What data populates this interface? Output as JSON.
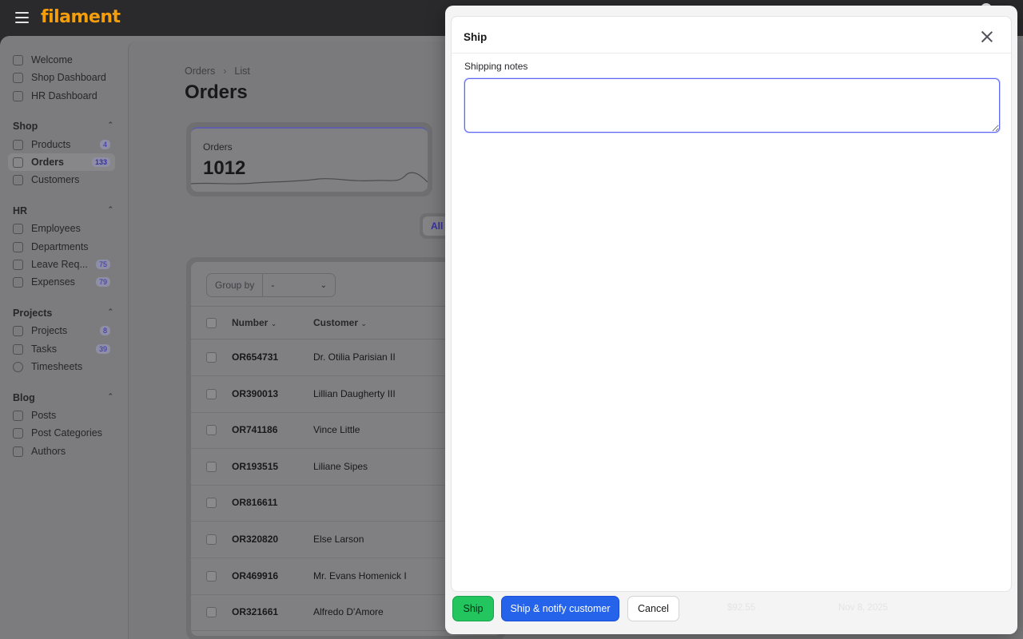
{
  "app": {
    "logo": "filament"
  },
  "sidebar": {
    "top_items": [
      {
        "label": "Welcome"
      },
      {
        "label": "Shop Dashboard"
      },
      {
        "label": "HR Dashboard"
      }
    ],
    "groups": [
      {
        "title": "Shop",
        "items": [
          {
            "label": "Products",
            "badge": "4"
          },
          {
            "label": "Orders",
            "badge": "133",
            "active": true
          },
          {
            "label": "Customers",
            "badge": ""
          }
        ]
      },
      {
        "title": "HR",
        "items": [
          {
            "label": "Employees",
            "badge": ""
          },
          {
            "label": "Departments",
            "badge": ""
          },
          {
            "label": "Leave Req...",
            "badge": "75"
          },
          {
            "label": "Expenses",
            "badge": "79"
          }
        ]
      },
      {
        "title": "Projects",
        "items": [
          {
            "label": "Projects",
            "badge": "8"
          },
          {
            "label": "Tasks",
            "badge": "39"
          },
          {
            "label": "Timesheets",
            "badge": ""
          }
        ]
      },
      {
        "title": "Blog",
        "items": [
          {
            "label": "Posts",
            "badge": ""
          },
          {
            "label": "Post Categories",
            "badge": ""
          },
          {
            "label": "Authors",
            "badge": ""
          }
        ]
      }
    ]
  },
  "page": {
    "breadcrumb": [
      "Orders",
      "List"
    ],
    "title": "Orders",
    "stat": {
      "label": "Orders",
      "value": "1012"
    },
    "tab_all": "All"
  },
  "table": {
    "group_by_label": "Group by",
    "group_by_value": "-",
    "columns": [
      "Number",
      "Customer"
    ],
    "rows": [
      {
        "number": "OR654731",
        "customer": "Dr. Otilia Parisian II"
      },
      {
        "number": "OR390013",
        "customer": "Lillian Daugherty III"
      },
      {
        "number": "OR741186",
        "customer": "Vince Little"
      },
      {
        "number": "OR193515",
        "customer": "Liliane Sipes"
      },
      {
        "number": "OR816611",
        "customer": ""
      },
      {
        "number": "OR320820",
        "customer": "Else Larson"
      },
      {
        "number": "OR469916",
        "customer": "Mr. Evans Homenick I"
      },
      {
        "number": "OR321661",
        "customer": "Alfredo D'Amore"
      }
    ],
    "behind_modal_last_row": {
      "amount": "$92.55",
      "date": "Nov 8, 2025"
    }
  },
  "modal": {
    "title": "Ship",
    "field_label": "Shipping notes",
    "field_value": "",
    "buttons": {
      "ship": "Ship",
      "ship_notify": "Ship & notify customer",
      "cancel": "Cancel"
    }
  },
  "colors": {
    "primary": "#f59e0b",
    "accent": "#6366f1",
    "ship_button": "#22c55e",
    "notify_button": "#2563eb"
  }
}
